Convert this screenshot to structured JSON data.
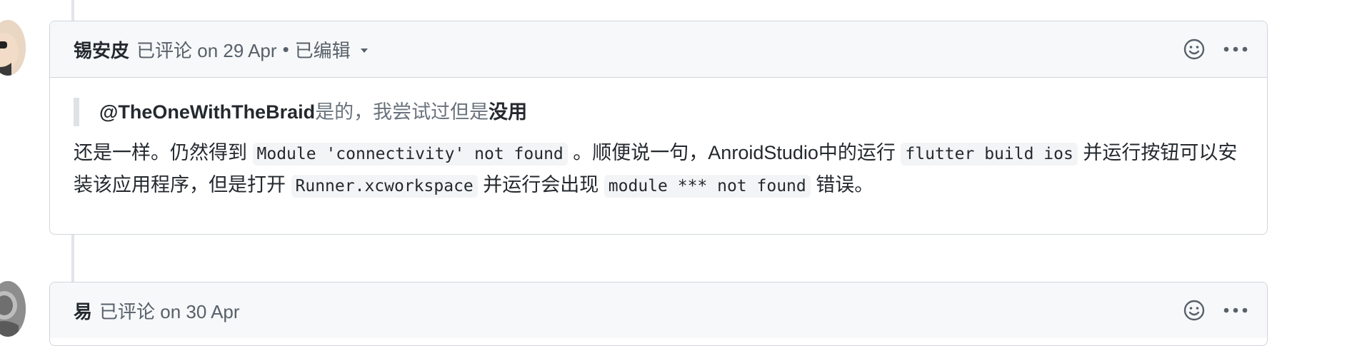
{
  "comments": [
    {
      "author": "锡安皮",
      "action": "已评论 on 29 Apr",
      "separator": "•",
      "edited_label": "已编辑",
      "quote": {
        "mention": "@TheOneWithTheBraid",
        "text": "是的，我尝试过但是",
        "strong": "没用"
      },
      "body": {
        "t1": "还是一样。仍然得到",
        "code1": "Module 'connectivity' not found",
        "t2": "。顺便说一句，AnroidStudio中的运行",
        "code2": "flutter build ios",
        "t3": "并运行按钮可以安装该应用程序，但是打开",
        "code3": "Runner.xcworkspace",
        "t4": "并运行会出现",
        "code4": "module *** not found",
        "t5": "错误。"
      }
    },
    {
      "author": "易",
      "action": "已评论 on 30 Apr"
    }
  ],
  "icons": {
    "reaction": "smiley-icon",
    "more": "kebab-horizontal-icon",
    "edited_dropdown": "triangle-down-icon"
  }
}
